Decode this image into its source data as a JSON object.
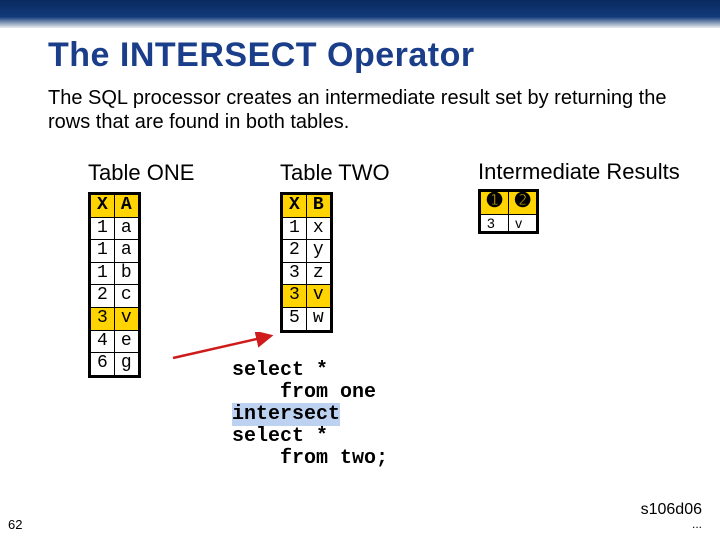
{
  "title": "The INTERSECT Operator",
  "subtitle": "The SQL processor creates an intermediate result set by returning the rows that are found in both tables.",
  "labels": {
    "table_one": "Table ONE",
    "table_two": "Table TWO",
    "intermediate": "Intermediate Results"
  },
  "table_one": {
    "headers": [
      "X",
      "A"
    ],
    "rows": [
      [
        "1",
        "a"
      ],
      [
        "1",
        "a"
      ],
      [
        "1",
        "b"
      ],
      [
        "2",
        "c"
      ],
      [
        "3",
        "v"
      ],
      [
        "4",
        "e"
      ],
      [
        "6",
        "g"
      ]
    ],
    "highlight_rows": [
      4
    ]
  },
  "table_two": {
    "headers": [
      "X",
      "B"
    ],
    "rows": [
      [
        "1",
        "x"
      ],
      [
        "2",
        "y"
      ],
      [
        "3",
        "z"
      ],
      [
        "3",
        "v"
      ],
      [
        "5",
        "w"
      ]
    ],
    "highlight_rows": [
      3
    ]
  },
  "intermediate": {
    "headers": [
      "➊",
      "➋"
    ],
    "rows": [
      [
        "3",
        "v"
      ]
    ]
  },
  "sql": {
    "lines": [
      "select *",
      "    from one",
      "intersect",
      "select *",
      "    from two;"
    ],
    "highlight_line": 2
  },
  "footer": {
    "page": "62",
    "sref": "s106d06",
    "dots": "..."
  },
  "icons": {
    "arrow_color": "#cf1b1b"
  }
}
